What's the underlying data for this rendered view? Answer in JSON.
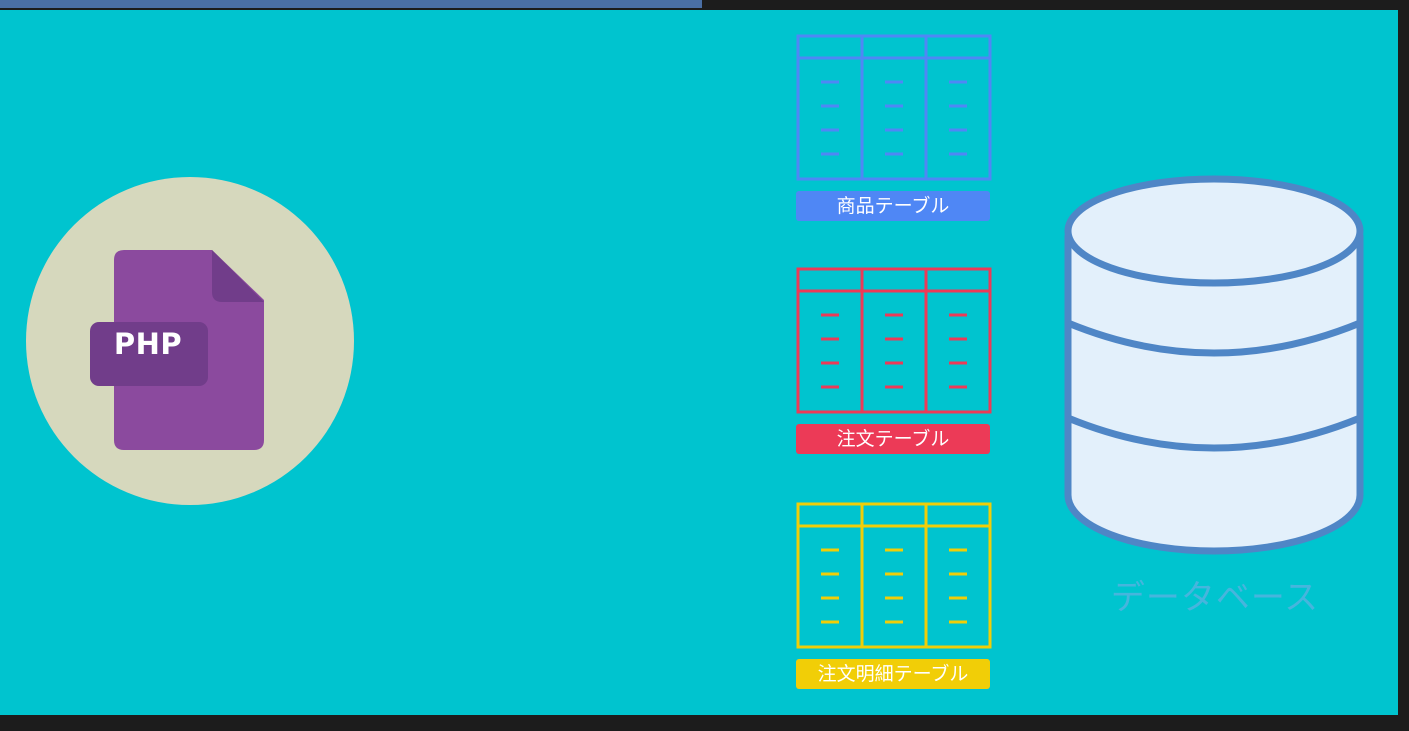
{
  "php": {
    "label": "PHP",
    "colors": {
      "circle": "#d6d8bd",
      "file": "#8b4a9e",
      "tab": "#713d8a"
    }
  },
  "tables": [
    {
      "caption": "商品テーブル",
      "color": "#4f87f5"
    },
    {
      "caption": "注文テーブル",
      "color": "#ec3a57"
    },
    {
      "caption": "注文明細テーブル",
      "color": "#f1ce07"
    }
  ],
  "database": {
    "label": "データベース",
    "colors": {
      "fill": "#e3f0fb",
      "stroke": "#4f86c6"
    }
  },
  "colors": {
    "background": "#00c4cf"
  }
}
